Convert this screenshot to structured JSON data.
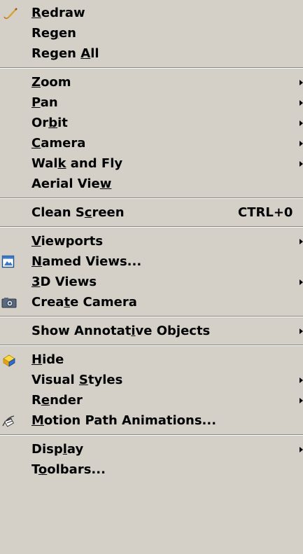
{
  "colors": {
    "menu_background": "#d4d0c8",
    "separator_dark": "#8a8780",
    "separator_light": "#ffffff",
    "text": "#000000"
  },
  "items": {
    "redraw": {
      "icon": "pencil-icon",
      "pre": "",
      "key": "R",
      "post": "edraw",
      "has_submenu": false
    },
    "regen": {
      "pre": "Re",
      "key": "g",
      "post": "en",
      "has_submenu": false
    },
    "regen_all": {
      "pre": "Regen ",
      "key": "A",
      "post": "ll",
      "has_submenu": false
    },
    "zoom": {
      "pre": "",
      "key": "Z",
      "post": "oom",
      "has_submenu": true
    },
    "pan": {
      "pre": "",
      "key": "P",
      "post": "an",
      "has_submenu": true
    },
    "orbit": {
      "pre": "Or",
      "key": "b",
      "post": "it",
      "has_submenu": true
    },
    "camera": {
      "pre": "",
      "key": "C",
      "post": "amera",
      "has_submenu": true
    },
    "walk_fly": {
      "pre": "Wal",
      "key": "k",
      "post": " and Fly",
      "has_submenu": true
    },
    "aerial_view": {
      "pre": "Aerial Vie",
      "key": "w",
      "post": "",
      "has_submenu": false
    },
    "clean_screen": {
      "pre": "Clean S",
      "key": "c",
      "post": "reen",
      "shortcut": "CTRL+0",
      "has_submenu": false
    },
    "viewports": {
      "pre": "",
      "key": "V",
      "post": "iewports",
      "has_submenu": true
    },
    "named_views": {
      "icon": "named-views-icon",
      "pre": "",
      "key": "N",
      "post": "amed Views...",
      "has_submenu": false
    },
    "views_3d": {
      "pre": "",
      "key": "3",
      "post": "D Views",
      "has_submenu": true
    },
    "create_camera": {
      "icon": "camera-icon",
      "pre": "Crea",
      "key": "t",
      "post": "e Camera",
      "has_submenu": false
    },
    "show_annotative": {
      "pre": "Show Annotat",
      "key": "i",
      "post": "ve Objects",
      "has_submenu": true
    },
    "hide": {
      "icon": "hide-icon",
      "pre": "",
      "key": "H",
      "post": "ide",
      "has_submenu": false
    },
    "visual_styles": {
      "pre": "Visual ",
      "key": "S",
      "post": "tyles",
      "has_submenu": true
    },
    "render": {
      "pre": "R",
      "key": "e",
      "post": "nder",
      "has_submenu": true
    },
    "motion_path": {
      "icon": "motion-path-icon",
      "pre": "",
      "key": "M",
      "post": "otion Path Animations...",
      "has_submenu": false
    },
    "display": {
      "pre": "Disp",
      "key": "l",
      "post": "ay",
      "has_submenu": true
    },
    "toolbars": {
      "pre": "T",
      "key": "o",
      "post": "olbars...",
      "has_submenu": false
    }
  }
}
